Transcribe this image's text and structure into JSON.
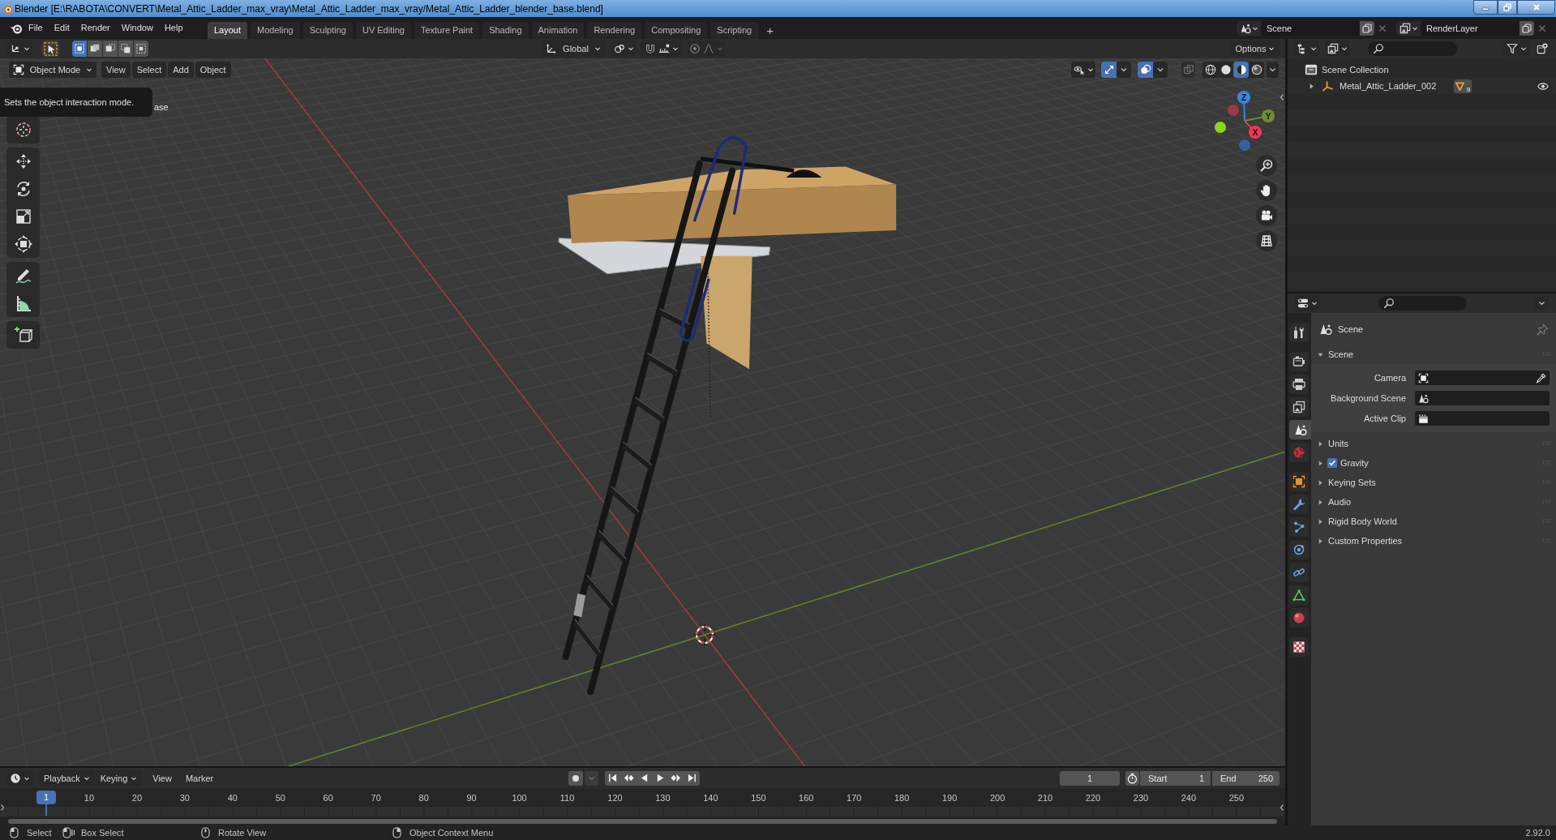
{
  "window": {
    "title": "Blender [E:\\RABOTA\\CONVERT\\Metal_Attic_Ladder_max_vray\\Metal_Attic_Ladder_max_vray/Metal_Attic_Ladder_blender_base.blend]"
  },
  "menu": [
    "File",
    "Edit",
    "Render",
    "Window",
    "Help"
  ],
  "workspaces": [
    {
      "label": "Layout",
      "selected": true
    },
    {
      "label": "Modeling",
      "selected": false
    },
    {
      "label": "Sculpting",
      "selected": false
    },
    {
      "label": "UV Editing",
      "selected": false
    },
    {
      "label": "Texture Paint",
      "selected": false
    },
    {
      "label": "Shading",
      "selected": false
    },
    {
      "label": "Animation",
      "selected": false
    },
    {
      "label": "Rendering",
      "selected": false
    },
    {
      "label": "Compositing",
      "selected": false
    },
    {
      "label": "Scripting",
      "selected": false
    }
  ],
  "add_workspace": "+",
  "scene": {
    "value": "Scene"
  },
  "view_layer": {
    "value": "RenderLayer"
  },
  "viewport": {
    "select_modes": [
      {
        "kind": "set",
        "selected": true
      },
      {
        "kind": "extend",
        "selected": false
      },
      {
        "kind": "subtract",
        "selected": false
      },
      {
        "kind": "invert",
        "selected": false
      },
      {
        "kind": "intersect",
        "selected": false
      }
    ],
    "orientation": "Global",
    "options": "Options",
    "mode": "Object Mode",
    "menus": [
      "View",
      "Select",
      "Add",
      "Object"
    ],
    "toggles": [
      {
        "kind": "gizmo",
        "on": true
      },
      {
        "kind": "overlay",
        "on": true
      },
      {
        "kind": "xray",
        "on": false
      }
    ],
    "shading": [
      {
        "kind": "wireframe",
        "selected": false
      },
      {
        "kind": "solid",
        "selected": false
      },
      {
        "kind": "material",
        "selected": true
      },
      {
        "kind": "rendered",
        "selected": false
      }
    ],
    "axes": [
      {
        "kind": "positive",
        "label": "Z",
        "color": "#3b84e0"
      },
      {
        "kind": "positive",
        "label": "Y",
        "color": "#6e8e29"
      },
      {
        "kind": "positive",
        "label": "X",
        "color": "#f0384f"
      },
      {
        "kind": "negative",
        "color": "#9a3a4a"
      },
      {
        "kind": "negative",
        "color": "#8bd41e"
      },
      {
        "kind": "negative",
        "color": "#35609e"
      }
    ],
    "tooltip": "Sets the object interaction mode.",
    "info_text": "ase"
  },
  "outliner": {
    "root": "Scene Collection",
    "items": [
      {
        "label": "Metal_Attic_Ladder_002",
        "expanded": false,
        "count": "9",
        "visible": true
      }
    ]
  },
  "properties": {
    "tab_groups": [
      [
        {
          "kind": "tool",
          "selected": false
        }
      ],
      [
        {
          "kind": "render",
          "selected": false
        },
        {
          "kind": "output",
          "selected": false
        },
        {
          "kind": "view_layer",
          "selected": false
        },
        {
          "kind": "scene",
          "selected": true
        },
        {
          "kind": "world",
          "selected": false
        }
      ],
      [
        {
          "kind": "object",
          "selected": false
        },
        {
          "kind": "modifiers",
          "selected": false
        },
        {
          "kind": "particles",
          "selected": false
        },
        {
          "kind": "physics",
          "selected": false
        },
        {
          "kind": "constraints",
          "selected": false
        },
        {
          "kind": "data",
          "selected": false
        },
        {
          "kind": "material",
          "selected": false
        }
      ],
      [
        {
          "kind": "texture",
          "selected": false
        }
      ]
    ],
    "context": "Scene",
    "panels": [
      {
        "kind": "plain",
        "label": "Scene",
        "expanded": true,
        "fields": [
          {
            "kind": "object",
            "label": "Camera"
          },
          {
            "kind": "scene",
            "label": "Background Scene"
          },
          {
            "kind": "clip",
            "label": "Active Clip"
          }
        ]
      },
      {
        "kind": "plain",
        "label": "Units",
        "expanded": false
      },
      {
        "kind": "checkbox",
        "label": "Gravity",
        "expanded": false,
        "checked": true
      },
      {
        "kind": "plain",
        "label": "Keying Sets",
        "expanded": false
      },
      {
        "kind": "plain",
        "label": "Audio",
        "expanded": false
      },
      {
        "kind": "plain",
        "label": "Rigid Body World",
        "expanded": false
      },
      {
        "kind": "plain",
        "label": "Custom Properties",
        "expanded": false
      }
    ]
  },
  "timeline": {
    "menus": [
      {
        "label": "Playback",
        "dropdown": true
      },
      {
        "label": "Keying",
        "dropdown": true
      },
      {
        "label": "View",
        "dropdown": false
      },
      {
        "label": "Marker",
        "dropdown": false
      }
    ],
    "auto_keying": {
      "on": false
    },
    "current_frame": "1",
    "start": {
      "label": "Start",
      "value": "1"
    },
    "end": {
      "label": "End",
      "value": "250"
    },
    "playhead": "1",
    "ruler": [
      "10",
      "20",
      "30",
      "40",
      "50",
      "60",
      "70",
      "80",
      "90",
      "100",
      "110",
      "120",
      "130",
      "140",
      "150",
      "160",
      "170",
      "180",
      "190",
      "200",
      "210",
      "220",
      "230",
      "240",
      "250"
    ]
  },
  "status_bar": {
    "hints": [
      {
        "kind": "left",
        "label": "Select"
      },
      {
        "kind": "drag",
        "label": "Box Select"
      },
      {
        "kind": "middle",
        "label": "Rotate View"
      },
      {
        "kind": "right",
        "label": "Object Context Menu"
      }
    ],
    "version": "2.92.0"
  }
}
